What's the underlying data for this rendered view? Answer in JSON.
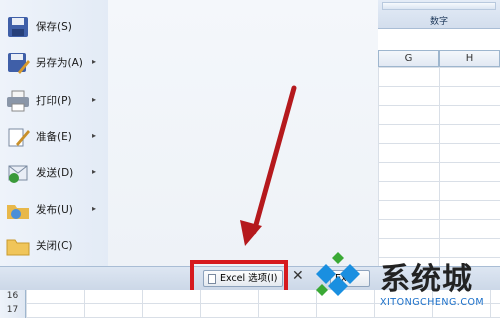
{
  "menu": {
    "items": [
      {
        "label": "保存(S)",
        "icon": "save-icon",
        "has_submenu": false
      },
      {
        "label": "另存为(A)",
        "icon": "save-as-icon",
        "has_submenu": true
      },
      {
        "label": "打印(P)",
        "icon": "printer-icon",
        "has_submenu": true
      },
      {
        "label": "准备(E)",
        "icon": "prepare-icon",
        "has_submenu": true
      },
      {
        "label": "发送(D)",
        "icon": "send-icon",
        "has_submenu": true
      },
      {
        "label": "发布(U)",
        "icon": "publish-icon",
        "has_submenu": true
      },
      {
        "label": "关闭(C)",
        "icon": "folder-icon",
        "has_submenu": false
      }
    ],
    "arrow_glyph": "▸"
  },
  "ribbon": {
    "group_label": "数字"
  },
  "grid": {
    "columns": [
      "G",
      "H"
    ]
  },
  "bottom": {
    "options_button": "Excel 选项(I)",
    "close_glyph": "✕",
    "exit_button": "Exc"
  },
  "rows": [
    {
      "num": "16"
    },
    {
      "num": "17"
    }
  ],
  "watermark": {
    "title": "系统城",
    "subtitle": "XITONGCHENG.COM"
  },
  "colors": {
    "highlight": "#d6191e",
    "arrow": "#b5191d",
    "watermark_blue": "#1a8fe0",
    "watermark_green": "#3aa935"
  }
}
